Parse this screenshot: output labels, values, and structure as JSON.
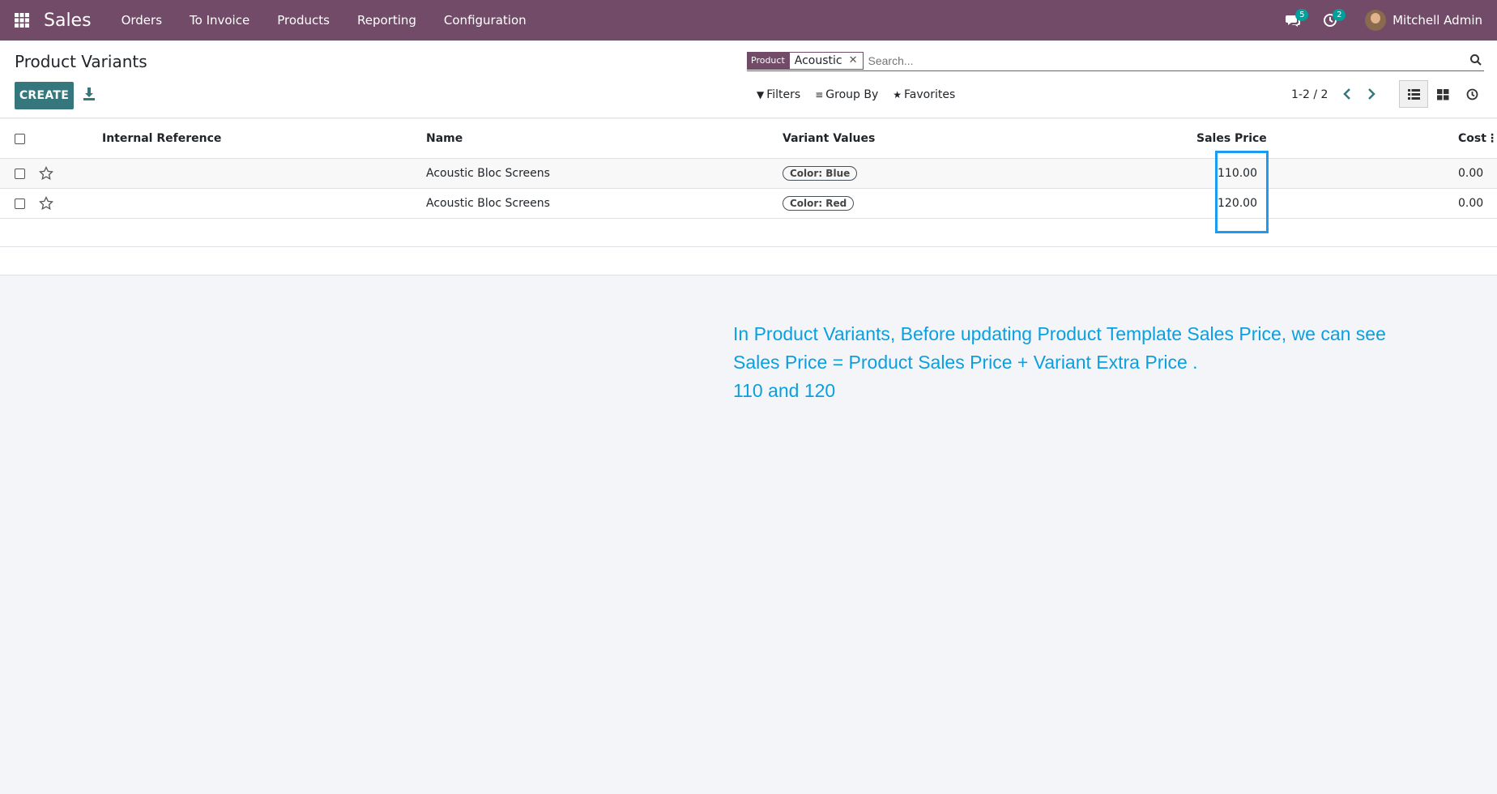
{
  "app": {
    "brand": "Sales",
    "menu": [
      "Orders",
      "To Invoice",
      "Products",
      "Reporting",
      "Configuration"
    ],
    "messages_count": "5",
    "activities_count": "2",
    "user_name": "Mitchell Admin"
  },
  "control_panel": {
    "title": "Product Variants",
    "create_label": "CREATE",
    "search": {
      "facet_label": "Product",
      "facet_value": "Acoustic",
      "placeholder": "Search..."
    },
    "filters_label": "Filters",
    "group_by_label": "Group By",
    "favorites_label": "Favorites",
    "pager": "1-2 / 2"
  },
  "table": {
    "columns": {
      "internal_reference": "Internal Reference",
      "name": "Name",
      "variant_values": "Variant Values",
      "sales_price": "Sales Price",
      "cost": "Cost"
    },
    "rows": [
      {
        "name": "Acoustic Bloc Screens",
        "variant": "Color: Blue",
        "sales_price": "110.00",
        "cost": "0.00"
      },
      {
        "name": "Acoustic Bloc Screens",
        "variant": "Color: Red",
        "sales_price": "120.00",
        "cost": "0.00"
      }
    ]
  },
  "annotation": {
    "line1": "In Product Variants, Before updating Product Template Sales Price, we can see",
    "line2": "Sales Price = Product Sales Price + Variant Extra Price .",
    "line3": "110 and 120"
  },
  "colors": {
    "nav": "#714b67",
    "primary_button": "#35777d",
    "annotation": "#0a9fe0",
    "highlight_box": "#1d9bf0"
  }
}
